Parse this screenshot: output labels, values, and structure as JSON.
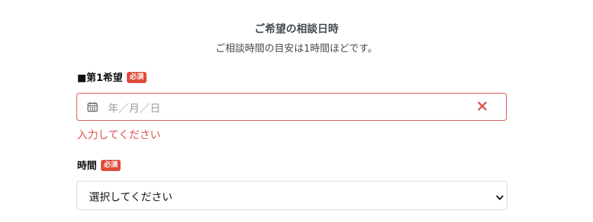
{
  "section": {
    "title": "ご希望の相談日時",
    "subtitle": "ご相談時間の目安は1時間ほどです。"
  },
  "first_choice": {
    "label": "■第1希望",
    "required_badge": "必須",
    "placeholder": "年／月／日",
    "calendar_icon": "calendar-icon",
    "clear_icon": "close-icon",
    "error": "入力してください"
  },
  "time": {
    "label": "時間",
    "required_badge": "必須",
    "selected": "選択してください",
    "chevron_icon": "chevron-down-icon"
  },
  "colors": {
    "error": "#d9534f",
    "badge": "#dd4b39",
    "heading": "#444b53"
  }
}
